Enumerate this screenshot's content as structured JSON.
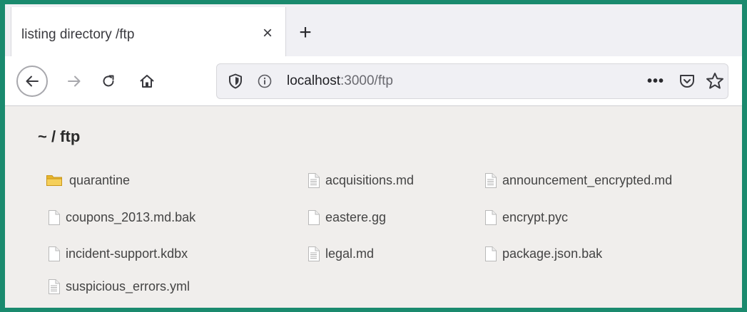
{
  "browser": {
    "tab": {
      "title": "listing directory /ftp",
      "close_glyph": "×"
    },
    "new_tab_glyph": "+",
    "address": {
      "host": "localhost",
      "rest": ":3000/ftp",
      "page_actions_glyph": "•••"
    }
  },
  "page": {
    "heading": "~ / ftp",
    "files": [
      {
        "name": "quarantine",
        "icon": "folder-icon"
      },
      {
        "name": "acquisitions.md",
        "icon": "text-file-icon"
      },
      {
        "name": "announcement_encrypted.md",
        "icon": "text-file-icon"
      },
      {
        "name": "coupons_2013.md.bak",
        "icon": "blank-file-icon"
      },
      {
        "name": "eastere.gg",
        "icon": "blank-file-icon"
      },
      {
        "name": "encrypt.pyc",
        "icon": "blank-file-icon"
      },
      {
        "name": "incident-support.kdbx",
        "icon": "blank-file-icon"
      },
      {
        "name": "legal.md",
        "icon": "text-file-icon"
      },
      {
        "name": "package.json.bak",
        "icon": "blank-file-icon"
      },
      {
        "name": "suspicious_errors.yml",
        "icon": "text-file-icon"
      }
    ]
  },
  "colors": {
    "frame": "#1a8a6e",
    "content_bg": "#f0eeec",
    "folder": "#f2c23b"
  }
}
